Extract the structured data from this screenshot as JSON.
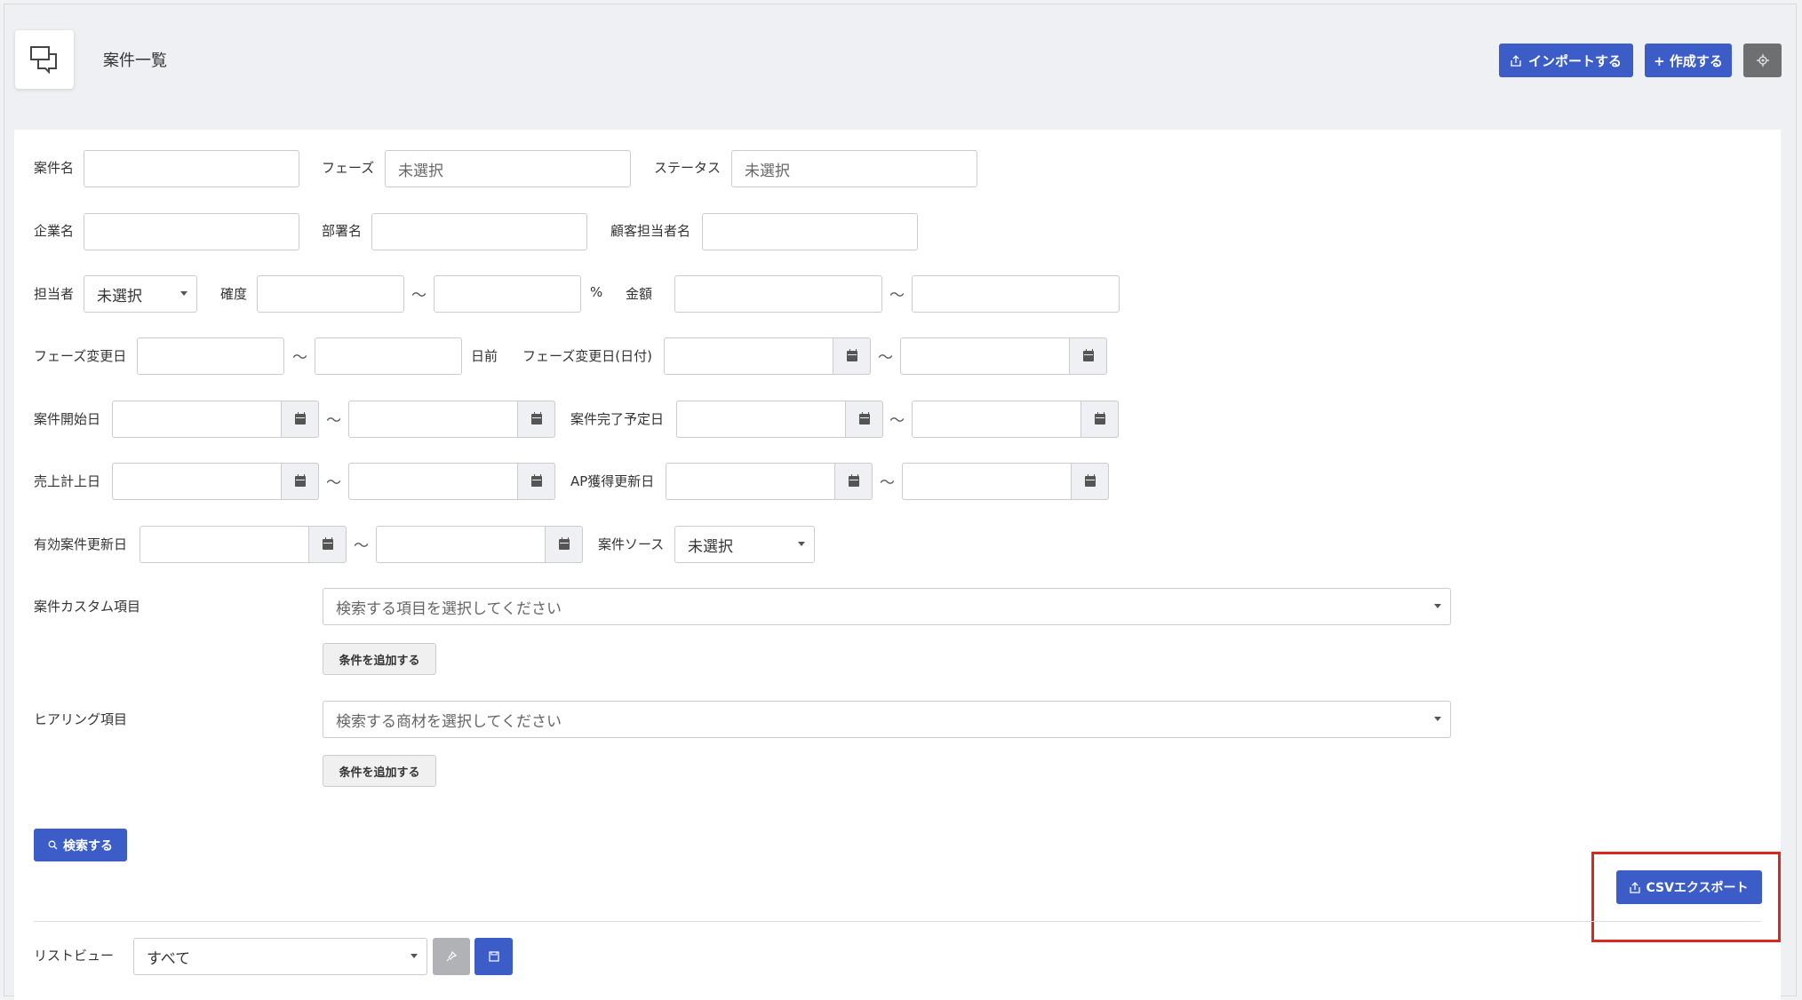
{
  "header": {
    "title": "案件一覧",
    "import_label": "インポートする",
    "create_label": "+ 作成する"
  },
  "filters": {
    "case_name": "案件名",
    "phase": "フェーズ",
    "phase_value": "未選択",
    "status": "ステータス",
    "status_value": "未選択",
    "company_name": "企業名",
    "department_name": "部署名",
    "client_contact": "顧客担当者名",
    "assignee": "担当者",
    "assignee_value": "未選択",
    "probability": "確度",
    "percent": "%",
    "amount": "金額",
    "phase_changed_days": "フェーズ変更日",
    "days_ago": "日前",
    "phase_changed_date": "フェーズ変更日(日付)",
    "case_start": "案件開始日",
    "case_complete_planned": "案件完了予定日",
    "sales_recorded": "売上計上日",
    "ap_acquired_updated": "AP獲得更新日",
    "valid_case_updated": "有効案件更新日",
    "case_source": "案件ソース",
    "case_source_value": "未選択",
    "range_separator": "〜",
    "custom_items": "案件カスタム項目",
    "custom_items_placeholder": "検索する項目を選択してください",
    "hearing_items": "ヒアリング項目",
    "hearing_items_placeholder": "検索する商材を選択してください",
    "add_condition": "条件を追加する",
    "search_label": "検索する"
  },
  "export": {
    "csv_label": "CSVエクスポート"
  },
  "list_view": {
    "label": "リストビュー",
    "value": "すべて"
  },
  "colors": {
    "accent": "#3c5cc8",
    "highlight": "#d9291c"
  },
  "icons": [
    "chat-bubbles-icon",
    "upload-icon",
    "gear-icon",
    "calendar-icon",
    "search-icon",
    "pin-icon",
    "save-icon"
  ]
}
